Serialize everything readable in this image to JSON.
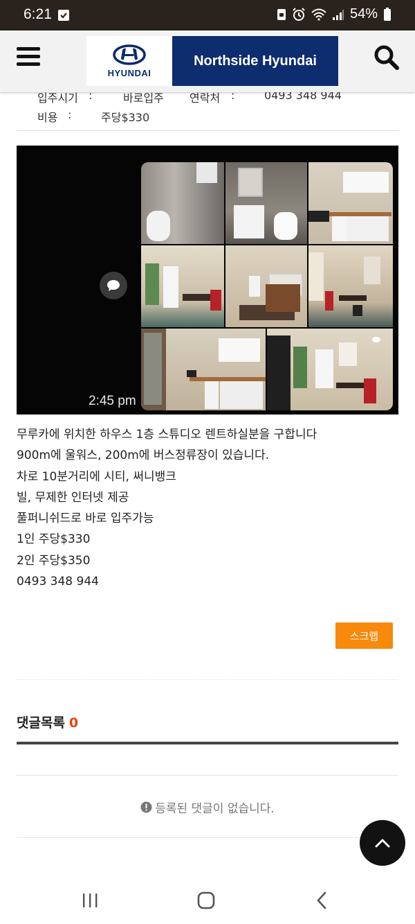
{
  "status_bar": {
    "time": "6:21",
    "battery": "54%"
  },
  "header": {
    "brand_small": "HYUNDAI",
    "dealer_name": "Northside Hyundai"
  },
  "info": {
    "move_in_label": "입주시기",
    "move_in_sep": ":",
    "move_in_value": "바로입주",
    "contact_label": "연락처",
    "contact_sep": ":",
    "contact_value": "0493 348 944",
    "cost_label": "비용",
    "cost_sep": ":",
    "cost_value": "주당$330"
  },
  "photo": {
    "timestamp": "2:45 pm"
  },
  "post_body": {
    "lines": [
      "무루카에 위치한 하우스 1층 스튜디오 렌트하실분을 구합니다",
      "900m에 울워스, 200m에 버스정류장이 있습니다.",
      "차로 10분거리에 시티, 써니뱅크",
      "빌, 무제한 인터넷 제공",
      "풀퍼니쉬드로 바로 입주가능",
      "1인 주당$330",
      "2인 주당$350",
      "0493 348 944"
    ]
  },
  "actions": {
    "scrap_label": "스크랩"
  },
  "comments": {
    "title": "댓글목록",
    "count": "0",
    "empty_message": "등록된 댓글이 없습니다."
  },
  "colors": {
    "accent": "#f7890c",
    "count": "#e8410f",
    "brand": "#0e2d6e"
  }
}
